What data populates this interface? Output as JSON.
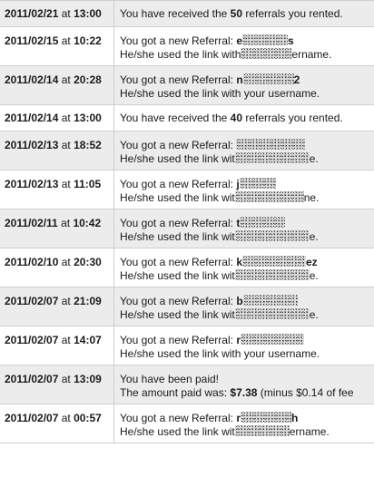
{
  "rows": [
    {
      "date": "2011/02/21",
      "at": "at",
      "time": "13:00",
      "line1_pre": "You have received the ",
      "line1_bold": "50",
      "line1_post": " referrals you rented."
    },
    {
      "date": "2011/02/15",
      "at": "at",
      "time": "10:22",
      "line1_pre": "You got a new Referral: ",
      "line1_bold": "e",
      "line1_bold_end": "s",
      "line2_pre": "He/she used the link with",
      "line2_post": "ername."
    },
    {
      "date": "2011/02/14",
      "at": "at",
      "time": "20:28",
      "line1_pre": "You got a new Referral: ",
      "line1_bold": "n",
      "line1_bold_end": "2",
      "line2": "He/she used the link with your username."
    },
    {
      "date": "2011/02/14",
      "at": "at",
      "time": "13:00",
      "line1_pre": "You have received the ",
      "line1_bold": "40",
      "line1_post": " referrals you rented."
    },
    {
      "date": "2011/02/13",
      "at": "at",
      "time": "18:52",
      "line1_pre": "You got a new Referral: ",
      "line2_pre": "He/she used the link wit",
      "line2_post": "e."
    },
    {
      "date": "2011/02/13",
      "at": "at",
      "time": "11:05",
      "line1_pre": "You got a new Referral: ",
      "line1_bold": "j",
      "line2_pre": "He/she used the link wit",
      "line2_post": "ne."
    },
    {
      "date": "2011/02/11",
      "at": "at",
      "time": "10:42",
      "line1_pre": "You got a new Referral: ",
      "line1_bold": "t",
      "line2_pre": "He/she used the link wit",
      "line2_post": "e."
    },
    {
      "date": "2011/02/10",
      "at": "at",
      "time": "20:30",
      "line1_pre": "You got a new Referral: ",
      "line1_bold": "k",
      "line1_bold_end": "ez",
      "line2_pre": "He/she used the link wit",
      "line2_post": "e."
    },
    {
      "date": "2011/02/07",
      "at": "at",
      "time": "21:09",
      "line1_pre": "You got a new Referral: ",
      "line1_bold": "b",
      "line2_pre": "He/she used the link wit",
      "line2_post": "e."
    },
    {
      "date": "2011/02/07",
      "at": "at",
      "time": "14:07",
      "line1_pre": "You got a new Referral: ",
      "line1_bold": "r",
      "line2": "He/she used the link with your username."
    },
    {
      "date": "2011/02/07",
      "at": "at",
      "time": "13:09",
      "line1": "You have been paid!",
      "line2_pre": "The amount paid was: ",
      "line2_bold": "$7.38",
      "line2_post": " (minus $0.14 of fee"
    },
    {
      "date": "2011/02/07",
      "at": "at",
      "time": "00:57",
      "line1_pre": "You got a new Referral: ",
      "line1_bold": "r",
      "line1_bold_end": "h",
      "line2_pre": "He/she used the link wit",
      "line2_post": "ername."
    }
  ]
}
